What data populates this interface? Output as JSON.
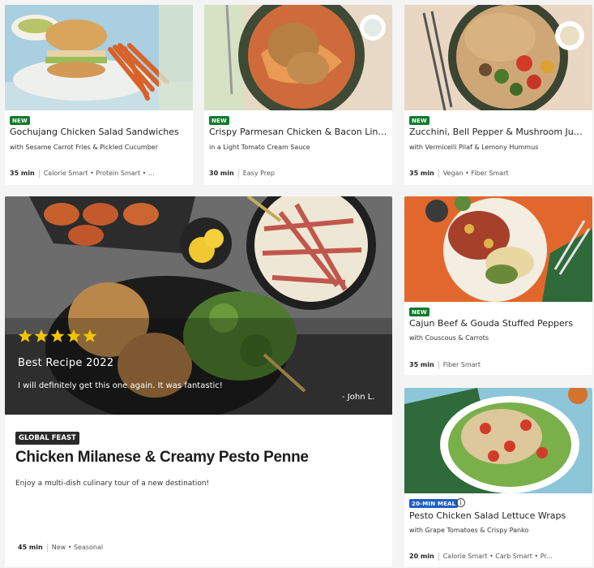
{
  "cards": [
    {
      "badge": "NEW",
      "title": "Gochujang Chicken Salad Sandwiches",
      "subtitle": "with Sesame Carrot Fries & Pickled Cucumber",
      "time": "35 min",
      "tags": "Calorie Smart • Protein Smart • ..."
    },
    {
      "badge": "NEW",
      "title": "Crispy Parmesan Chicken & Bacon Linguine",
      "subtitle": "in a Light Tomato Cream Sauce",
      "time": "30 min",
      "tags": "Easy Prep"
    },
    {
      "badge": "NEW",
      "title": "Zucchini, Bell Pepper & Mushroom Jumble",
      "subtitle": "with Vermicelli Pilaf & Lemony Hummus",
      "time": "35 min",
      "tags": "Vegan • Fiber Smart"
    },
    {
      "badge": "NEW",
      "title": "Cajun Beef & Gouda Stuffed Peppers",
      "subtitle": "with Couscous & Carrots",
      "time": "35 min",
      "tags": "Fiber Smart"
    },
    {
      "badge": "20-MIN MEAL",
      "title": "Pesto Chicken Salad Lettuce Wraps",
      "subtitle": "with Grape Tomatoes & Crispy Panko",
      "time": "20 min",
      "tags": "Calorie Smart • Carb Smart • Pr..."
    }
  ],
  "feature": {
    "rating_stars": 5,
    "award": "Best Recipe 2022",
    "quote": "I will definitely get this one again. It was fantastic!",
    "author": "- John L.",
    "tag": "GLOBAL FEAST",
    "title": "Chicken Milanese & Creamy Pesto Penne",
    "description": "Enjoy a multi-dish culinary tour of a new destination!",
    "time": "45 min",
    "tags": "New • Seasonal"
  },
  "colors": {
    "new_badge": "#0d7a2a",
    "quick_badge": "#1f5fc4",
    "star": "#f5c400"
  }
}
